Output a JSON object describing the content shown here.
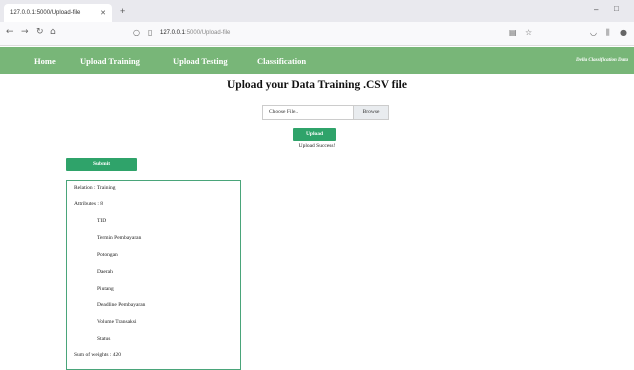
{
  "browser": {
    "tab_title": "127.0.0.1:5000/Upload-file",
    "url_host": "127.0.0.1",
    "url_rest": ":5000/Upload-file"
  },
  "menu": {
    "items": [
      "Home",
      "Upload Training",
      "Upload Testing",
      "Classification"
    ],
    "brand": "Della Classification Data"
  },
  "main": {
    "title": "Upload your Data Training .CSV file",
    "file_input_placeholder": "Choose File..",
    "browse_label": "Browse",
    "upload_label": "Upload",
    "upload_status": "Upload Success!",
    "submit_label": "Submit"
  },
  "result": {
    "relation": "Relation : Training",
    "attributes_label": "Attributes : 8",
    "attributes": [
      "TID",
      "Termin Pembayaran",
      "Potongan",
      "Daerah",
      "Piutang",
      "Deadline Pembayaran",
      "Volume Transaksi",
      "Status"
    ],
    "sum_weights": "Sum of weights : 420"
  },
  "icons": {
    "back": "back-arrow-icon",
    "forward": "forward-arrow-icon",
    "reload": "reload-icon",
    "home": "home-icon",
    "shield": "shield-icon",
    "page": "page-icon",
    "reader": "reader-mode-icon",
    "bookmark": "star-icon",
    "pocket": "pocket-icon",
    "library": "library-icon",
    "extension": "extension-icon"
  },
  "colors": {
    "menu_bg": "#78b678",
    "button_green": "#2fa36a",
    "box_border": "#4aa57a"
  }
}
